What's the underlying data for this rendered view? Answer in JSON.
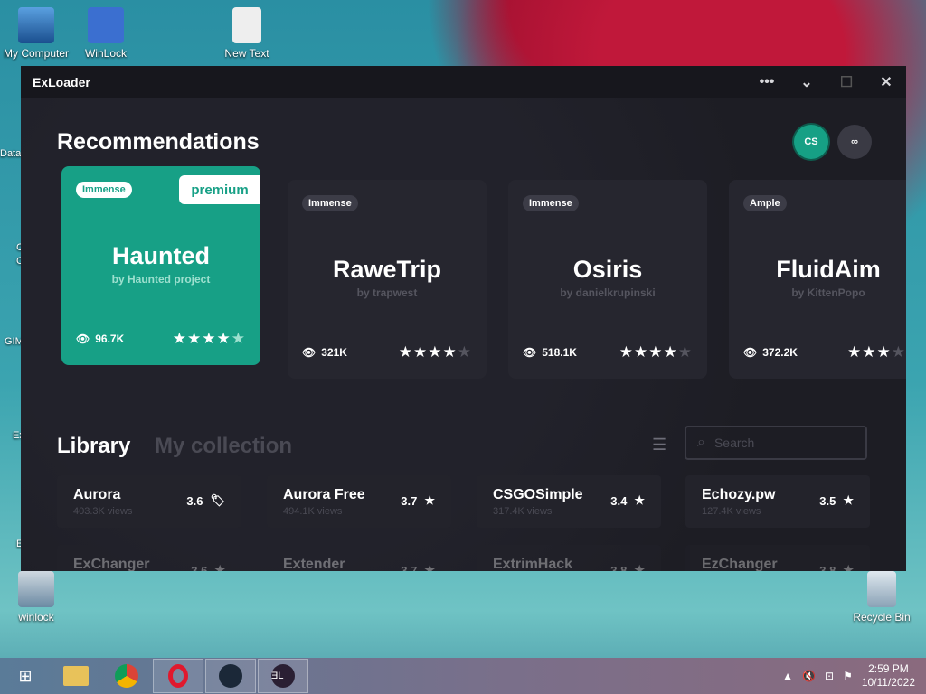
{
  "desktop": {
    "icons": [
      {
        "label": "My Computer"
      },
      {
        "label": "WinLock"
      },
      {
        "label": "New Text"
      },
      {
        "label": "winlock"
      },
      {
        "label": "Recycle Bin"
      }
    ],
    "edge_labels": [
      "Data",
      "C",
      "C",
      "GIM",
      "Ex",
      "E"
    ]
  },
  "window": {
    "title": "ExLoader",
    "controls": {
      "more": "•••",
      "minimize": "⌄",
      "maximize": "☐",
      "close": "✕"
    }
  },
  "recommendations": {
    "heading": "Recommendations",
    "game_buttons": [
      {
        "label": "CS"
      },
      {
        "label": "∞"
      }
    ],
    "cards": [
      {
        "tag": "Immense",
        "badge": "premium",
        "name": "Haunted",
        "author": "by Haunted project",
        "views": "96.7K",
        "stars_on": 4,
        "stars_total": 5,
        "active": true
      },
      {
        "tag": "Immense",
        "name": "RaweTrip",
        "author": "by trapwest",
        "views": "321K",
        "stars_on": 4,
        "stars_total": 5
      },
      {
        "tag": "Immense",
        "name": "Osiris",
        "author": "by danielkrupinski",
        "views": "518.1K",
        "stars_on": 4,
        "stars_total": 5
      },
      {
        "tag": "Ample",
        "name": "FluidAim",
        "author": "by KittenPopo",
        "views": "372.2K",
        "stars_on": 3,
        "stars_total": 4
      }
    ]
  },
  "library": {
    "tab_active": "Library",
    "tab_inactive": "My collection",
    "search_placeholder": "Search",
    "items": [
      {
        "name": "Aurora",
        "views": "403.3K views",
        "rating": "3.6",
        "icon": "tag-icon"
      },
      {
        "name": "Aurora Free",
        "views": "494.1K views",
        "rating": "3.7",
        "icon": "star-icon"
      },
      {
        "name": "CSGOSimple",
        "views": "317.4K views",
        "rating": "3.4",
        "icon": "star-icon"
      },
      {
        "name": "Echozy.pw",
        "views": "127.4K views",
        "rating": "3.5",
        "icon": "star-icon"
      },
      {
        "name": "ExChanger",
        "views": "",
        "rating": "3.6",
        "icon": "star-icon"
      },
      {
        "name": "Extender",
        "views": "",
        "rating": "3.7",
        "icon": "star-icon"
      },
      {
        "name": "ExtrimHack",
        "views": "",
        "rating": "3.8",
        "icon": "star-icon"
      },
      {
        "name": "EzChanger",
        "views": "",
        "rating": "3.8",
        "icon": "star-icon"
      }
    ]
  },
  "taskbar": {
    "time": "2:59 PM",
    "date": "10/11/2022"
  }
}
